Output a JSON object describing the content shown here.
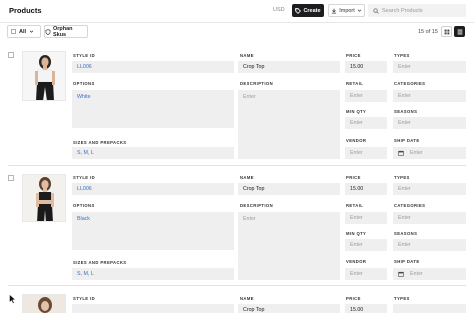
{
  "header": {
    "title": "Products",
    "currency": "USD",
    "create_label": "Create",
    "import_label": "Import",
    "search_placeholder": "Search Products"
  },
  "toolbar": {
    "bulk_label": "All",
    "orphan_label": "Orphan Skus",
    "pagination": "15 of 15"
  },
  "labels": {
    "style_id": "STYLE ID",
    "options": "OPTIONS",
    "sizes": "SIZES AND PREPACKS",
    "name": "NAME",
    "description": "DESCRIPTION",
    "price": "PRICE",
    "retail": "RETAIL",
    "min_qty": "MIN QTY",
    "vendor": "VENDOR",
    "types": "TYPES",
    "categories": "CATEGORIES",
    "seasons": "SEASONS",
    "ship_date": "SHIP DATE"
  },
  "products": [
    {
      "style_id": "LL006",
      "options": "White",
      "sizes": "S, M, L",
      "name": "Crop Top",
      "description": "Enter",
      "price": "15.00",
      "retail": "Enter",
      "min_qty": "Enter",
      "vendor": "Enter",
      "types": "Enter",
      "categories": "Enter",
      "seasons": "Enter",
      "ship_date": "Enter",
      "photo_colors": {
        "top": "#f4f4f4",
        "hair": "#2a2520",
        "skin": "#d9b59a",
        "outfit": "#1c1c1c"
      }
    },
    {
      "style_id": "LL006",
      "options": "Black",
      "sizes": "S, M, L",
      "name": "Crop Top",
      "description": "Enter",
      "price": "15.00",
      "retail": "Enter",
      "min_qty": "Enter",
      "vendor": "Enter",
      "types": "Enter",
      "categories": "Enter",
      "seasons": "Enter",
      "ship_date": "Enter",
      "photo_colors": {
        "top": "#1c1c1c",
        "hair": "#5a4030",
        "skin": "#e0bca2",
        "outfit": "#1a1a1a"
      }
    },
    {
      "style_id": "",
      "name": "Crop Top",
      "price": "15.00",
      "photo_colors": {
        "top": "#e9d8c8",
        "hair": "#6b4a35",
        "skin": "#e3c2a8",
        "outfit": "#e8d6c4"
      }
    }
  ]
}
